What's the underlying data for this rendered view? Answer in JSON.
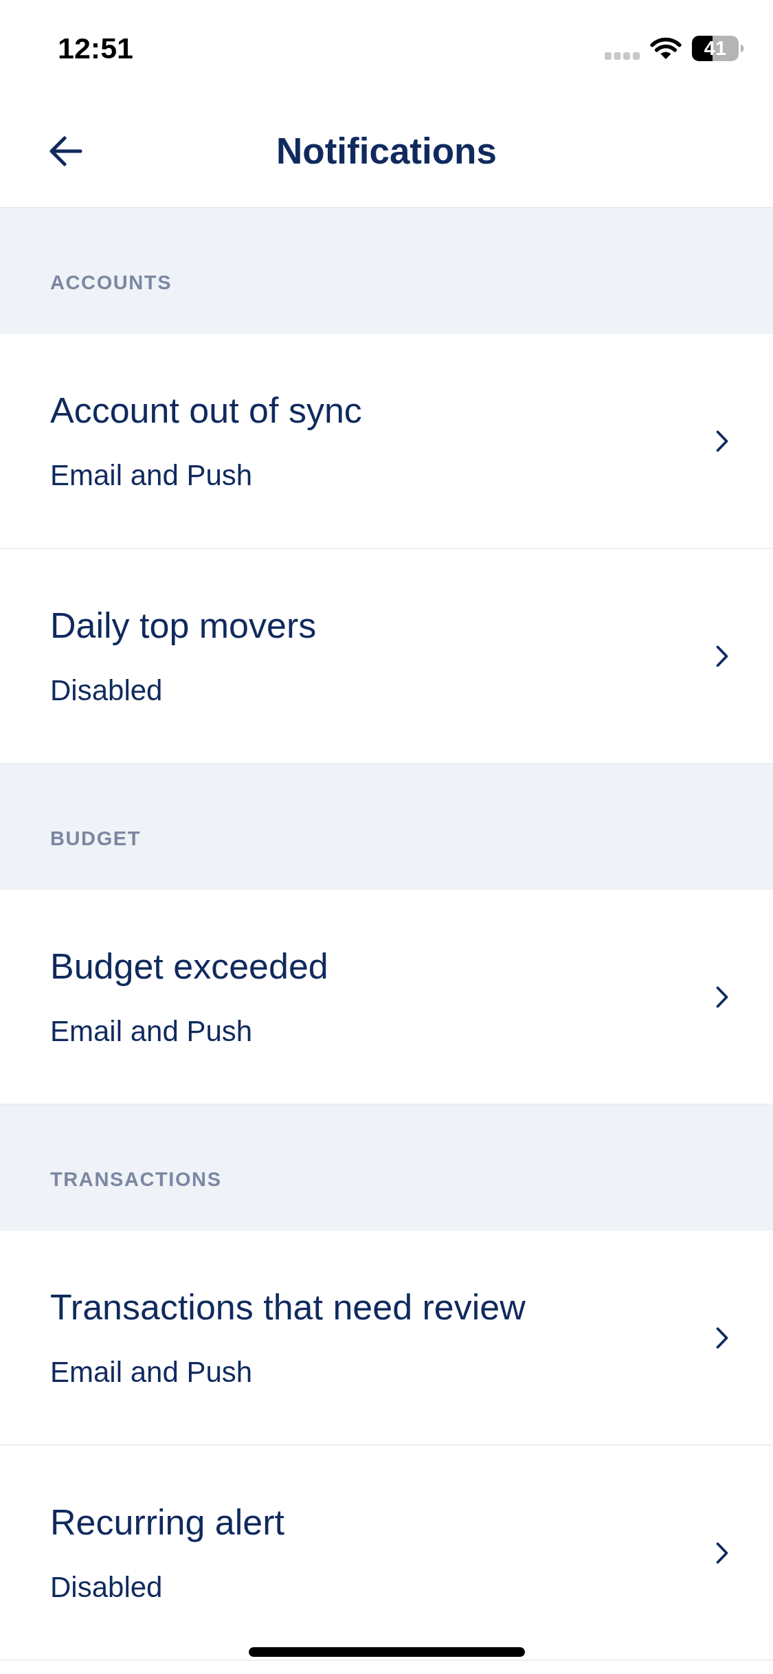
{
  "status_bar": {
    "time": "12:51",
    "battery": "41"
  },
  "header": {
    "title": "Notifications"
  },
  "sections": [
    {
      "label": "ACCOUNTS",
      "items": [
        {
          "title": "Account out of sync",
          "status": "Email and Push"
        },
        {
          "title": "Daily top movers",
          "status": "Disabled"
        }
      ]
    },
    {
      "label": "BUDGET",
      "items": [
        {
          "title": "Budget exceeded",
          "status": "Email and Push"
        }
      ]
    },
    {
      "label": "TRANSACTIONS",
      "items": [
        {
          "title": "Transactions that need review",
          "status": "Email and Push"
        },
        {
          "title": "Recurring alert",
          "status": "Disabled"
        }
      ]
    }
  ]
}
